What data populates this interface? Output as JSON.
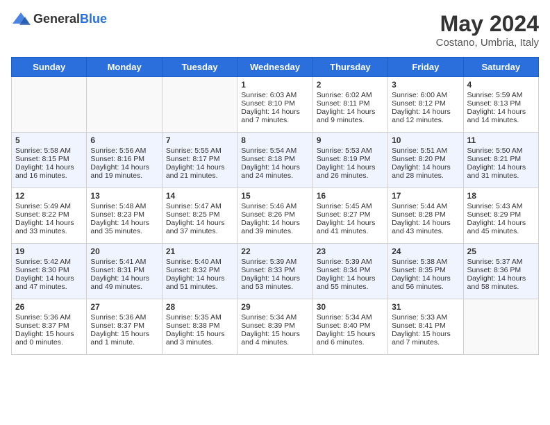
{
  "header": {
    "logo_general": "General",
    "logo_blue": "Blue",
    "title": "May 2024",
    "subtitle": "Costano, Umbria, Italy"
  },
  "weekdays": [
    "Sunday",
    "Monday",
    "Tuesday",
    "Wednesday",
    "Thursday",
    "Friday",
    "Saturday"
  ],
  "weeks": [
    [
      {
        "day": "",
        "content": ""
      },
      {
        "day": "",
        "content": ""
      },
      {
        "day": "",
        "content": ""
      },
      {
        "day": "1",
        "content": "Sunrise: 6:03 AM\nSunset: 8:10 PM\nDaylight: 14 hours\nand 7 minutes."
      },
      {
        "day": "2",
        "content": "Sunrise: 6:02 AM\nSunset: 8:11 PM\nDaylight: 14 hours\nand 9 minutes."
      },
      {
        "day": "3",
        "content": "Sunrise: 6:00 AM\nSunset: 8:12 PM\nDaylight: 14 hours\nand 12 minutes."
      },
      {
        "day": "4",
        "content": "Sunrise: 5:59 AM\nSunset: 8:13 PM\nDaylight: 14 hours\nand 14 minutes."
      }
    ],
    [
      {
        "day": "5",
        "content": "Sunrise: 5:58 AM\nSunset: 8:15 PM\nDaylight: 14 hours\nand 16 minutes."
      },
      {
        "day": "6",
        "content": "Sunrise: 5:56 AM\nSunset: 8:16 PM\nDaylight: 14 hours\nand 19 minutes."
      },
      {
        "day": "7",
        "content": "Sunrise: 5:55 AM\nSunset: 8:17 PM\nDaylight: 14 hours\nand 21 minutes."
      },
      {
        "day": "8",
        "content": "Sunrise: 5:54 AM\nSunset: 8:18 PM\nDaylight: 14 hours\nand 24 minutes."
      },
      {
        "day": "9",
        "content": "Sunrise: 5:53 AM\nSunset: 8:19 PM\nDaylight: 14 hours\nand 26 minutes."
      },
      {
        "day": "10",
        "content": "Sunrise: 5:51 AM\nSunset: 8:20 PM\nDaylight: 14 hours\nand 28 minutes."
      },
      {
        "day": "11",
        "content": "Sunrise: 5:50 AM\nSunset: 8:21 PM\nDaylight: 14 hours\nand 31 minutes."
      }
    ],
    [
      {
        "day": "12",
        "content": "Sunrise: 5:49 AM\nSunset: 8:22 PM\nDaylight: 14 hours\nand 33 minutes."
      },
      {
        "day": "13",
        "content": "Sunrise: 5:48 AM\nSunset: 8:23 PM\nDaylight: 14 hours\nand 35 minutes."
      },
      {
        "day": "14",
        "content": "Sunrise: 5:47 AM\nSunset: 8:25 PM\nDaylight: 14 hours\nand 37 minutes."
      },
      {
        "day": "15",
        "content": "Sunrise: 5:46 AM\nSunset: 8:26 PM\nDaylight: 14 hours\nand 39 minutes."
      },
      {
        "day": "16",
        "content": "Sunrise: 5:45 AM\nSunset: 8:27 PM\nDaylight: 14 hours\nand 41 minutes."
      },
      {
        "day": "17",
        "content": "Sunrise: 5:44 AM\nSunset: 8:28 PM\nDaylight: 14 hours\nand 43 minutes."
      },
      {
        "day": "18",
        "content": "Sunrise: 5:43 AM\nSunset: 8:29 PM\nDaylight: 14 hours\nand 45 minutes."
      }
    ],
    [
      {
        "day": "19",
        "content": "Sunrise: 5:42 AM\nSunset: 8:30 PM\nDaylight: 14 hours\nand 47 minutes."
      },
      {
        "day": "20",
        "content": "Sunrise: 5:41 AM\nSunset: 8:31 PM\nDaylight: 14 hours\nand 49 minutes."
      },
      {
        "day": "21",
        "content": "Sunrise: 5:40 AM\nSunset: 8:32 PM\nDaylight: 14 hours\nand 51 minutes."
      },
      {
        "day": "22",
        "content": "Sunrise: 5:39 AM\nSunset: 8:33 PM\nDaylight: 14 hours\nand 53 minutes."
      },
      {
        "day": "23",
        "content": "Sunrise: 5:39 AM\nSunset: 8:34 PM\nDaylight: 14 hours\nand 55 minutes."
      },
      {
        "day": "24",
        "content": "Sunrise: 5:38 AM\nSunset: 8:35 PM\nDaylight: 14 hours\nand 56 minutes."
      },
      {
        "day": "25",
        "content": "Sunrise: 5:37 AM\nSunset: 8:36 PM\nDaylight: 14 hours\nand 58 minutes."
      }
    ],
    [
      {
        "day": "26",
        "content": "Sunrise: 5:36 AM\nSunset: 8:37 PM\nDaylight: 15 hours\nand 0 minutes."
      },
      {
        "day": "27",
        "content": "Sunrise: 5:36 AM\nSunset: 8:37 PM\nDaylight: 15 hours\nand 1 minute."
      },
      {
        "day": "28",
        "content": "Sunrise: 5:35 AM\nSunset: 8:38 PM\nDaylight: 15 hours\nand 3 minutes."
      },
      {
        "day": "29",
        "content": "Sunrise: 5:34 AM\nSunset: 8:39 PM\nDaylight: 15 hours\nand 4 minutes."
      },
      {
        "day": "30",
        "content": "Sunrise: 5:34 AM\nSunset: 8:40 PM\nDaylight: 15 hours\nand 6 minutes."
      },
      {
        "day": "31",
        "content": "Sunrise: 5:33 AM\nSunset: 8:41 PM\nDaylight: 15 hours\nand 7 minutes."
      },
      {
        "day": "",
        "content": ""
      }
    ]
  ]
}
